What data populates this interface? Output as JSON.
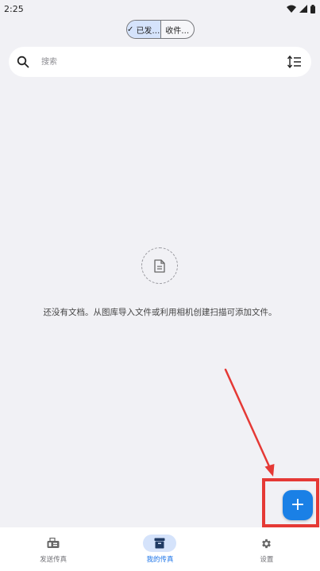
{
  "status_bar": {
    "time": "2:25"
  },
  "segmented": {
    "check": "✓",
    "options": [
      {
        "label": "已发…",
        "selected": true
      },
      {
        "label": "收件…",
        "selected": false
      }
    ]
  },
  "search": {
    "placeholder": "搜索",
    "value": ""
  },
  "empty_state": {
    "message": "还没有文档。从图库导入文件或利用相机创建扫描可添加文件。",
    "icon": "document-icon"
  },
  "fab": {
    "label": "+",
    "icon": "plus-icon"
  },
  "annotation": {
    "color": "#e53935"
  },
  "bottom_nav": {
    "items": [
      {
        "label": "发送传真",
        "icon": "fax-icon",
        "active": false
      },
      {
        "label": "我的传真",
        "icon": "archive-icon",
        "active": true
      },
      {
        "label": "设置",
        "icon": "gear-icon",
        "active": false
      }
    ]
  },
  "colors": {
    "accent": "#1a80e6",
    "selected_bg": "#d5e3fb",
    "background": "#f1f1f5"
  }
}
